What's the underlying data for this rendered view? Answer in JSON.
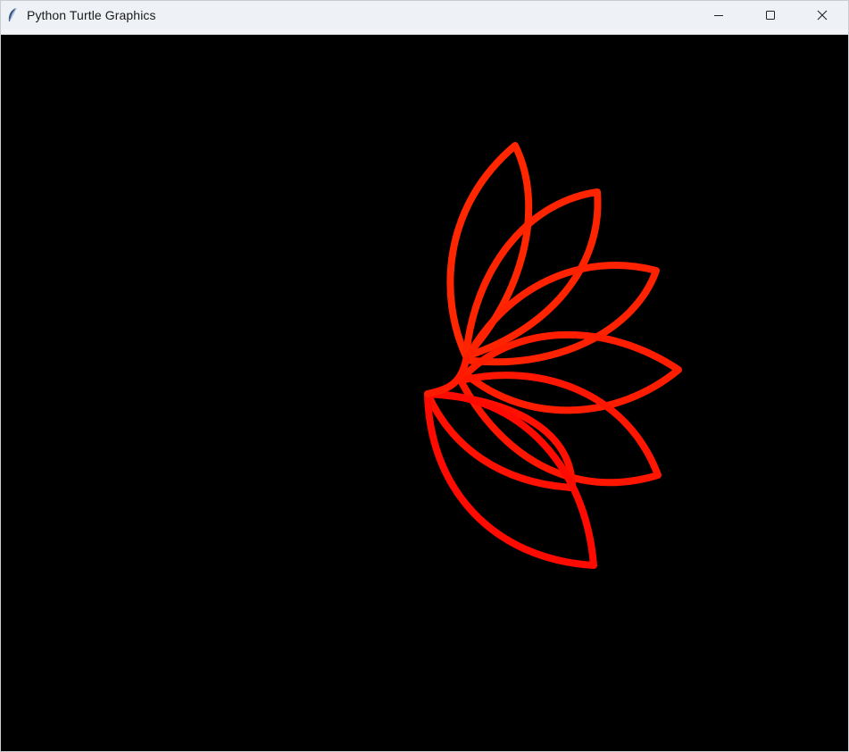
{
  "window": {
    "title": "Python Turtle Graphics",
    "app_icon": "feather-icon",
    "controls": [
      "minimize-icon",
      "maximize-icon",
      "close-icon"
    ]
  },
  "canvas": {
    "background_color": "#000000",
    "pen_color_start": "#ff2a00",
    "pen_color_end": "#ff0000",
    "shape": "petals",
    "petal_count": 8
  }
}
